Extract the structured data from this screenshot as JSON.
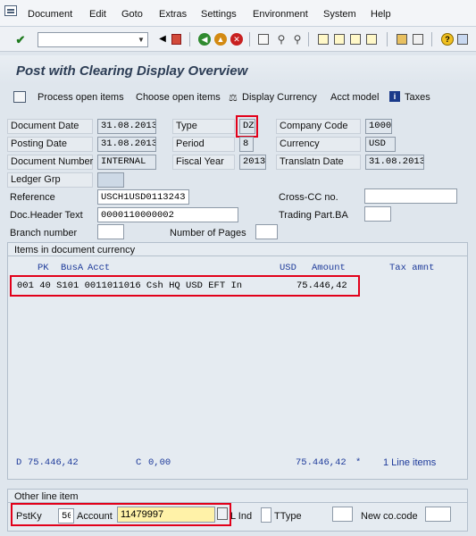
{
  "menu": {
    "items": [
      "Document",
      "Edit",
      "Goto",
      "Extras",
      "Settings",
      "Environment",
      "System",
      "Help"
    ]
  },
  "toolbar": {
    "command_value": "",
    "icons": [
      "enter-check-icon",
      "back-arrow-icon",
      "save-icon",
      "back-icon",
      "exit-icon",
      "cancel-icon",
      "print-icon",
      "find-icon",
      "find-next-icon",
      "first-page-icon",
      "previous-page-icon",
      "next-page-icon",
      "last-page-icon",
      "create-session-icon",
      "shortcut-icon",
      "help-icon",
      "layout-menu-icon"
    ]
  },
  "title": "Post with Clearing Display Overview",
  "app_toolbar": {
    "process_open_items": "Process open items",
    "choose_open_items": "Choose open items",
    "display_currency": "Display Currency",
    "acct_model": "Acct model",
    "taxes": "Taxes"
  },
  "header": {
    "document_date_label": "Document Date",
    "document_date": "31.08.2013",
    "type_label": "Type",
    "type": "DZ",
    "company_code_label": "Company Code",
    "company_code": "1000",
    "posting_date_label": "Posting Date",
    "posting_date": "31.08.2013",
    "period_label": "Period",
    "period": "8",
    "currency_label": "Currency",
    "currency": "USD",
    "document_number_label": "Document Number",
    "document_number": "INTERNAL",
    "fiscal_year_label": "Fiscal Year",
    "fiscal_year": "2013",
    "translatn_date_label": "Translatn Date",
    "translatn_date": "31.08.2013",
    "ledger_grp_label": "Ledger Grp",
    "ledger_grp": "",
    "reference_label": "Reference",
    "reference": "USCH1USD0113243",
    "cross_cc_label": "Cross-CC no.",
    "cross_cc": "",
    "doc_header_text_label": "Doc.Header Text",
    "doc_header_text": "0000110000002",
    "trading_part_ba_label": "Trading Part.BA",
    "trading_part_ba": "",
    "branch_number_label": "Branch number",
    "branch_number": "",
    "number_of_pages_label": "Number of Pages",
    "number_of_pages": ""
  },
  "items": {
    "group_title": "Items in document currency",
    "columns": {
      "pk": "PK",
      "busa": "BusA",
      "acct": "Acct",
      "usd": "USD",
      "amount": "Amount",
      "tax_amnt": "Tax amnt"
    },
    "rows": [
      {
        "line": "001 40  S101 0011011016 Csh HQ USD EFT In",
        "amount": "75.446,42"
      }
    ],
    "footer": {
      "d_label": "D",
      "d_value": "75.446,42",
      "c_label": "C",
      "c_value": "0,00",
      "balance": "75.446,42",
      "star": "*",
      "line_items": "1 Line items"
    }
  },
  "other_line_item": {
    "group_title": "Other line item",
    "pstky_label": "PstKy",
    "pstky": "50",
    "account_label": "Account",
    "account": "11479997",
    "ind_label": "L Ind",
    "ind": "",
    "ttype_label": "TType",
    "ttype": "",
    "new_cocode_label": "New co.code",
    "new_cocode": ""
  }
}
